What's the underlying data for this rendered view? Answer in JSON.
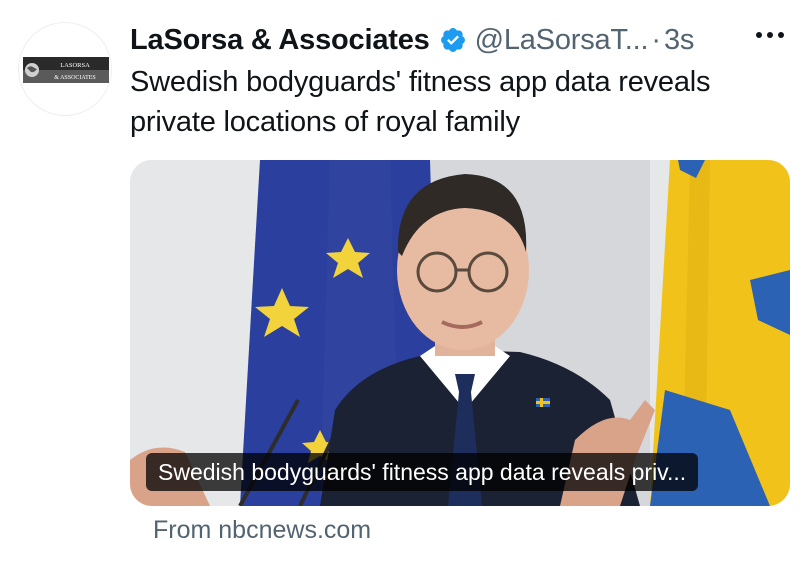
{
  "author": {
    "display_name": "LaSorsa & Associates",
    "handle": "@LaSorsaT...",
    "time": "3s",
    "avatar_logo_top": "LASORSA",
    "avatar_logo_bottom": "& ASSOCIATES",
    "verified": true
  },
  "tweet": {
    "separator": "·",
    "text": "Swedish bodyguards' fitness app data reveals private locations of royal family"
  },
  "card": {
    "caption": "Swedish bodyguards' fitness app data reveals priv...",
    "source": "From nbcnews.com"
  },
  "icons": {
    "verified": "verified-badge-icon",
    "more": "more-dots-icon"
  },
  "colors": {
    "verified_blue": "#1d9bf0",
    "secondary_text": "#536471",
    "eu_blue": "#2b3f9e",
    "eu_star": "#f2d33c",
    "sweden_yellow": "#f1c31a",
    "sweden_blue": "#2c62b4"
  }
}
